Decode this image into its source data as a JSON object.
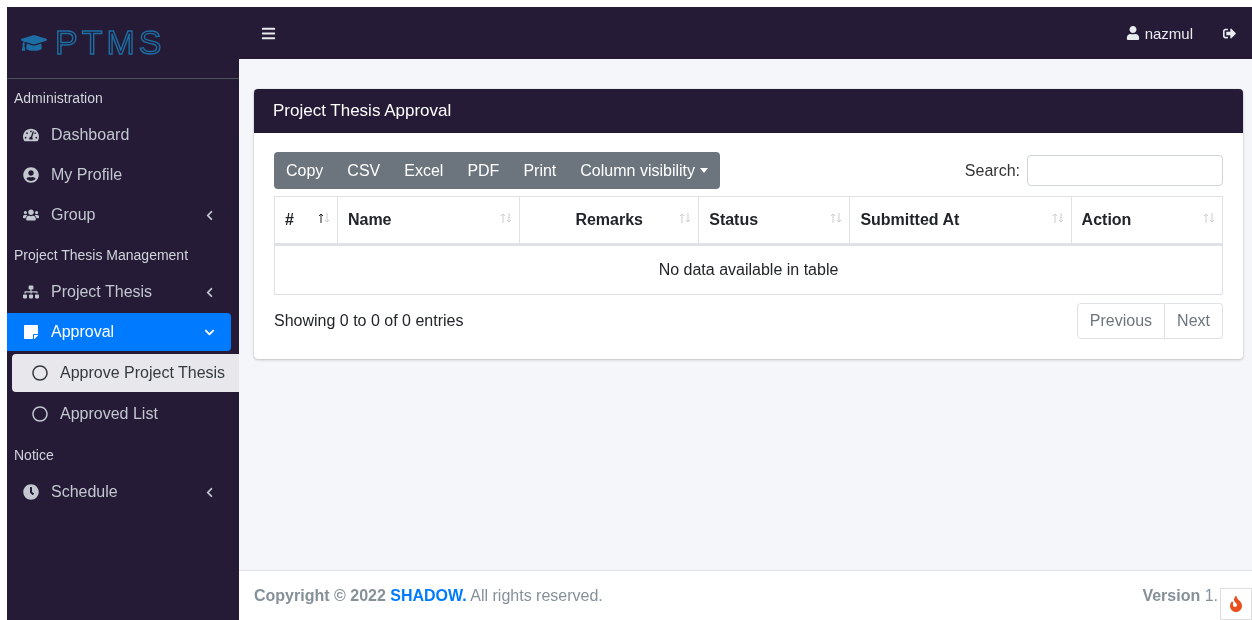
{
  "sidebar": {
    "logo": "PTMS",
    "sections": [
      {
        "header": "Administration",
        "items": [
          {
            "label": "Dashboard",
            "selected": false
          },
          {
            "label": "My Profile",
            "selected": false
          },
          {
            "label": "Group",
            "selected": false,
            "expanded": false
          }
        ]
      },
      {
        "header": "Project Thesis Management",
        "items": [
          {
            "label": "Project Thesis",
            "selected": false,
            "expanded": false
          },
          {
            "label": "Approval",
            "selected": true,
            "expanded": true,
            "children": [
              {
                "label": "Approve Project Thesis",
                "selected": true
              },
              {
                "label": "Approved List",
                "selected": false
              }
            ]
          }
        ]
      },
      {
        "header": "Notice",
        "items": [
          {
            "label": "Schedule",
            "selected": false,
            "expanded": false
          }
        ]
      }
    ]
  },
  "topbar": {
    "user": "nazmul"
  },
  "card": {
    "title": "Project Thesis Approval",
    "buttons": [
      {
        "label": "Copy"
      },
      {
        "label": "CSV"
      },
      {
        "label": "Excel"
      },
      {
        "label": "PDF"
      },
      {
        "label": "Print"
      },
      {
        "label": "Column visibility",
        "dropdown": true
      }
    ],
    "search": {
      "label": "Search:"
    },
    "table": {
      "columns": [
        {
          "label": "#",
          "sorted": true
        },
        {
          "label": "Name",
          "sorted": false
        },
        {
          "label": "Remarks",
          "sorted": false
        },
        {
          "label": "Status",
          "sorted": false
        },
        {
          "label": "Submitted At",
          "sorted": false
        },
        {
          "label": "Action",
          "sorted": false
        }
      ],
      "empty": "No data available in table"
    },
    "info": "Showing 0 to 0 of 0 entries",
    "pagination": [
      {
        "label": "Previous",
        "disabled": true
      },
      {
        "label": "Next",
        "disabled": true
      }
    ]
  },
  "footer": {
    "copyright": "**Copyright © 2022** ",
    "link": "SHADOW.",
    "rights": " All rights reserved.",
    "version": "**Version** 1."
  }
}
